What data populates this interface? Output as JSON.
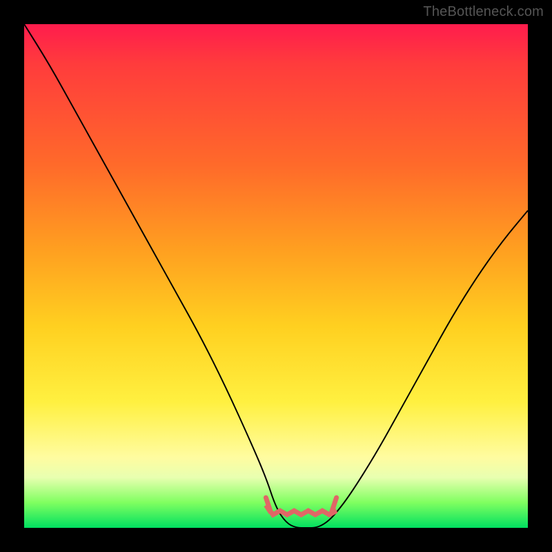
{
  "watermark": "TheBottleneck.com",
  "chart_data": {
    "type": "line",
    "title": "",
    "xlabel": "",
    "ylabel": "",
    "xlim": [
      0,
      100
    ],
    "ylim": [
      0,
      100
    ],
    "x": [
      0,
      5,
      10,
      15,
      20,
      25,
      30,
      35,
      40,
      45,
      48,
      50,
      52,
      54,
      56,
      58,
      60,
      62,
      65,
      70,
      75,
      80,
      85,
      90,
      95,
      100
    ],
    "values": [
      100,
      92,
      83,
      74,
      65,
      56,
      47,
      38,
      28,
      17,
      10,
      4,
      1,
      0,
      0,
      0,
      1,
      3,
      7,
      15,
      24,
      33,
      42,
      50,
      57,
      63
    ],
    "annotations": [
      {
        "text": "trough-marker",
        "x_start": 48,
        "x_end": 62,
        "y": 3,
        "color": "#e06666"
      }
    ],
    "background_gradient": {
      "stops": [
        {
          "pos": 0,
          "color": "#ff1c4d"
        },
        {
          "pos": 28,
          "color": "#ff6a2a"
        },
        {
          "pos": 60,
          "color": "#ffd020"
        },
        {
          "pos": 86,
          "color": "#fffca0"
        },
        {
          "pos": 100,
          "color": "#00e060"
        }
      ]
    }
  }
}
